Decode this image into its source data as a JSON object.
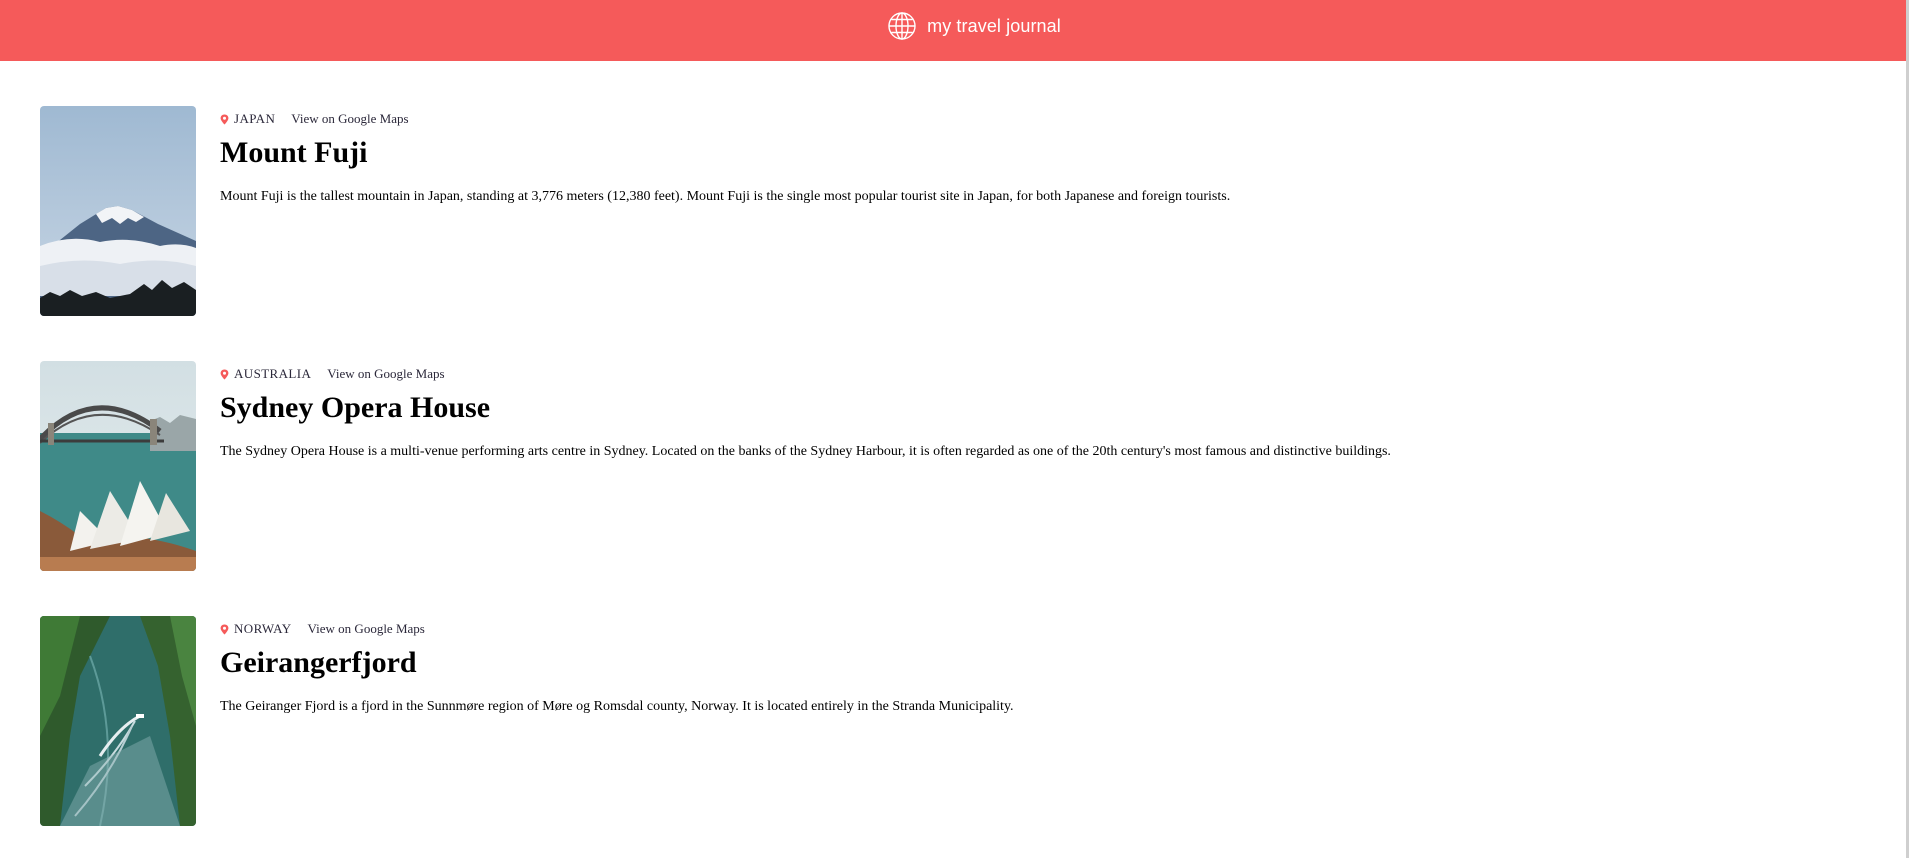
{
  "header": {
    "title": "my travel journal",
    "icon": "globe-icon",
    "background": "#F55A5A"
  },
  "entries": [
    {
      "country": "JAPAN",
      "map_link": "View on Google Maps",
      "title": "Mount Fuji",
      "description": "Mount Fuji is the tallest mountain in Japan, standing at 3,776 meters (12,380 feet). Mount Fuji is the single most popular tourist site in Japan, for both Japanese and foreign tourists.",
      "icon": "map-pin-icon"
    },
    {
      "country": "AUSTRALIA",
      "map_link": "View on Google Maps",
      "title": "Sydney Opera House",
      "description": "The Sydney Opera House is a multi-venue performing arts centre in Sydney. Located on the banks of the Sydney Harbour, it is often regarded as one of the 20th century's most famous and distinctive buildings.",
      "icon": "map-pin-icon"
    },
    {
      "country": "NORWAY",
      "map_link": "View on Google Maps",
      "title": "Geirangerfjord",
      "description": "The Geiranger Fjord is a fjord in the Sunnmøre region of Møre og Romsdal county, Norway. It is located entirely in the Stranda Municipality.",
      "icon": "map-pin-icon"
    }
  ],
  "colors": {
    "accent": "#F55A5A",
    "text_dark": "#2B283A"
  }
}
